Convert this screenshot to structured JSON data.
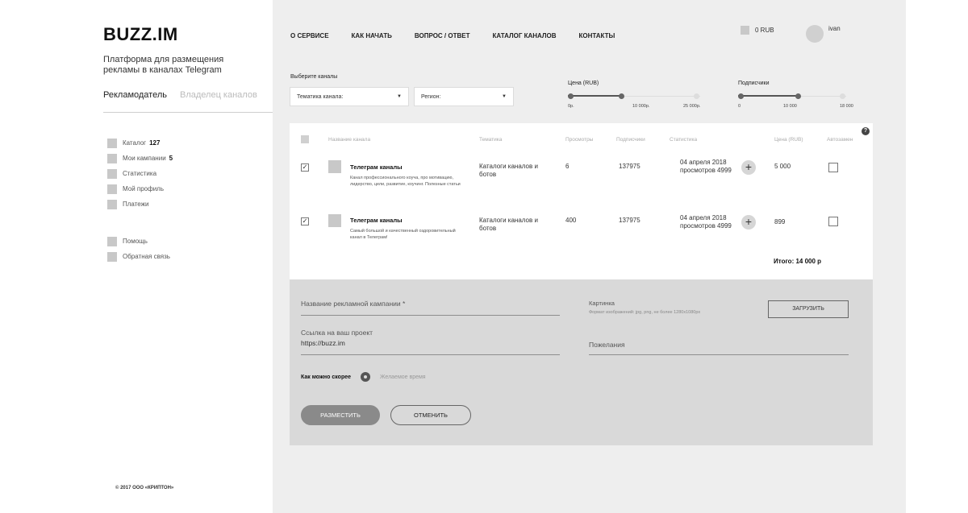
{
  "brand": {
    "logo": "BUZZ.IM",
    "tagline": "Платформа для размещения рекламы в каналах Telegram"
  },
  "role_tabs": [
    {
      "label": "Рекламодатель",
      "active": true
    },
    {
      "label": "Владелец каналов",
      "active": false
    }
  ],
  "menu": [
    {
      "label": "Каталог",
      "count": "127"
    },
    {
      "label": "Мои кампании",
      "count": "5"
    },
    {
      "label": "Статистика",
      "count": ""
    },
    {
      "label": "Мой профиль",
      "count": ""
    },
    {
      "label": "Платежи",
      "count": ""
    }
  ],
  "menu_secondary": [
    {
      "label": "Помощь"
    },
    {
      "label": "Обратная связь"
    }
  ],
  "copyright": "© 2017 ООО «КРИПТОН»",
  "nav": [
    "О СЕРВИСЕ",
    "КАК НАЧАТЬ",
    "ВОПРОС / ОТВЕТ",
    "КАТАЛОГ КАНАЛОВ",
    "КОНТАКТЫ"
  ],
  "balance": "0 RUB",
  "user": "ivan",
  "filters": {
    "label": "Выберите каналы",
    "theme_select": "Тематика канала:",
    "region_select": "Регион:",
    "price": {
      "title": "Цена (RUB)",
      "ticks": [
        "0р.",
        "10 000р.",
        "25 000р."
      ],
      "min": 0,
      "max": 25000,
      "selected_max": 10000
    },
    "subscribers": {
      "title": "Подписчики",
      "ticks": [
        "0",
        "10 000",
        "18 000"
      ],
      "min": 0,
      "max": 18000,
      "selected_max": 10000
    }
  },
  "table": {
    "headers": {
      "name": "Название канала",
      "theme": "Тематика",
      "views": "Просмотры",
      "subs": "Подписчики",
      "stats": "Статистика",
      "price": "Цена (RUB)",
      "auto": "Автозамен"
    },
    "help": "?",
    "rows": [
      {
        "checked": "✓",
        "name": "Телеграм каналы",
        "desc": "Канал профессионального коуча, про мотивацию, лидерство, цели, развитие, коучинг. Полезные статьи",
        "theme": "Каталоги каналов и ботов",
        "views": "6",
        "subs": "137975",
        "stat_date": "04 апреля 2018",
        "stat_views": "просмотров 4999",
        "price": "5 000"
      },
      {
        "checked": "✓",
        "name": "Телеграм каналы",
        "desc": "Самый большой и качественный оздоровительный канал в Телеграм!",
        "theme": "Каталоги каналов и ботов",
        "views": "400",
        "subs": "137975",
        "stat_date": "04 апреля 2018",
        "stat_views": "просмотров 4999",
        "price": "899"
      }
    ],
    "plus": "+",
    "total": "Итого: 14 000 р"
  },
  "form": {
    "campaign_name": "Название рекламной кампании *",
    "link_label": "Ссылка на ваш проект",
    "link_value": "https://buzz.im",
    "image_label": "Картинка",
    "image_hint": "Формат изображений: jpg, png, не более 1280x1080px",
    "upload": "ЗАГРУЗИТЬ",
    "wishes": "Пожелания",
    "asap": "Как можно скорее",
    "desired_time": "Желаемое время",
    "submit": "РАЗМЕСТИТЬ",
    "cancel": "ОТМЕНИТЬ"
  }
}
